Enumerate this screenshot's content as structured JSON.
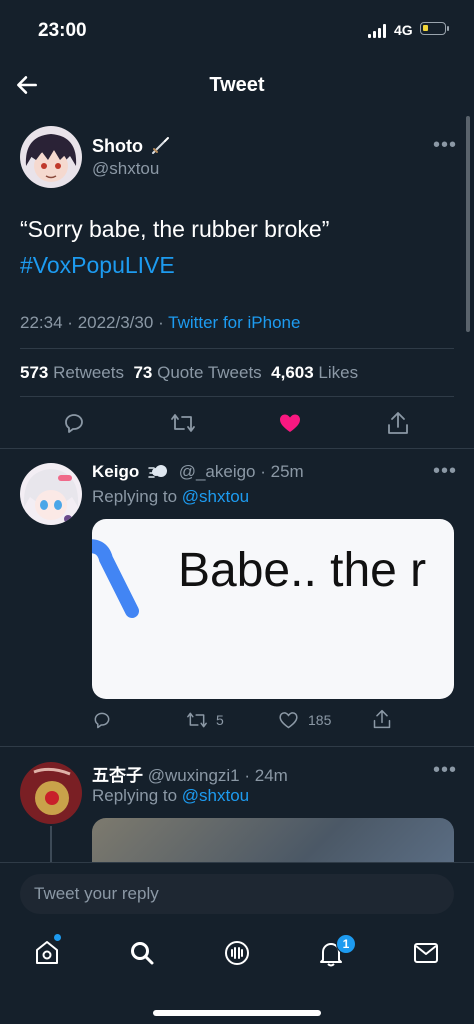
{
  "status_bar": {
    "time": "23:00",
    "network": "4G"
  },
  "header": {
    "title": "Tweet"
  },
  "tweet": {
    "author_name": "Shoto",
    "author_handle": "@shxtou",
    "text": "“Sorry babe, the rubber broke”",
    "hashtag": "#VoxPopuLIVE",
    "time": "22:34",
    "date": "2022/3/30",
    "separator": "·",
    "source": "Twitter for iPhone",
    "stats": {
      "retweets_count": "573",
      "retweets_label": "Retweets",
      "quotes_count": "73",
      "quotes_label": "Quote Tweets",
      "likes_count": "4,603",
      "likes_label": "Likes"
    },
    "colors": {
      "like": "#f91880",
      "link": "#1d9bf0"
    }
  },
  "replies": [
    {
      "name": "Keigo",
      "handle": "@_akeigo",
      "age": "25m",
      "replying_to_label": "Replying to",
      "replying_to": "@shxtou",
      "image_text": "Babe.. the r",
      "retweet_count": "5",
      "like_count": "185"
    },
    {
      "name": "五杏子",
      "handle": "@wuxingzi1",
      "age": "24m",
      "replying_to_label": "Replying to",
      "replying_to": "@shxtou"
    }
  ],
  "composer": {
    "placeholder": "Tweet your reply"
  },
  "tabbar": {
    "notifications_badge": "1"
  }
}
